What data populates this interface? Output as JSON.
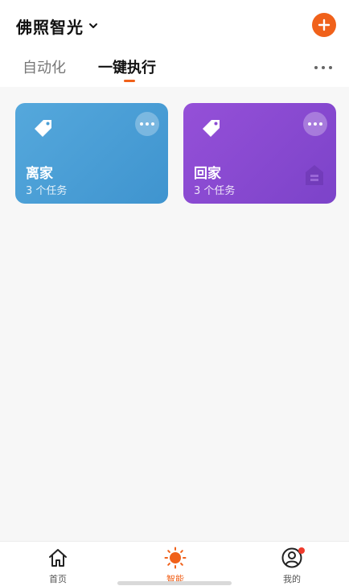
{
  "header": {
    "home_name": "佛照智光",
    "add_icon": "plus-icon",
    "accent_color": "#f0611a"
  },
  "tabs": [
    {
      "label": "自动化",
      "active": false
    },
    {
      "label": "一键执行",
      "active": true
    }
  ],
  "scenes": [
    {
      "title": "离家",
      "subtitle": "3 个任务",
      "color": "#4a9fd6",
      "icon": "tag-icon"
    },
    {
      "title": "回家",
      "subtitle": "3 个任务",
      "color": "#8a4ad2",
      "icon": "tag-icon"
    }
  ],
  "tabbar": [
    {
      "label": "首页",
      "icon": "home-icon",
      "active": false
    },
    {
      "label": "智能",
      "icon": "sun-icon",
      "active": true
    },
    {
      "label": "我的",
      "icon": "user-icon",
      "active": false,
      "badge": true
    }
  ]
}
